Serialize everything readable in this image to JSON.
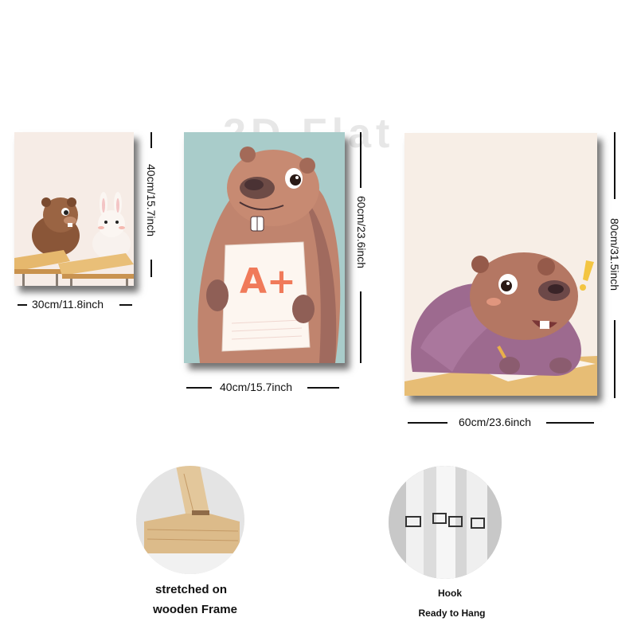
{
  "watermark": "2D Flat",
  "sizes": {
    "small": {
      "width": "30cm/11.8inch",
      "height": "40cm/15.7inch"
    },
    "medium": {
      "width": "40cm/15.7inch",
      "height": "60cm/23.6inch"
    },
    "large": {
      "width": "60cm/23.6inch",
      "height": "80cm/31.5inch"
    }
  },
  "paintings": {
    "medium": {
      "paper_text": "A+"
    }
  },
  "details": {
    "frame": {
      "caption_line1": "stretched on",
      "caption_line2": "wooden Frame"
    },
    "hook": {
      "caption_title": "Hook",
      "caption_sub": "Ready to Hang"
    }
  },
  "colors": {
    "small_bg": "#f6ece6",
    "medium_bg": "#a9ccca",
    "large_bg": "#f7eee6",
    "capybara": "#b47763",
    "grade": "#f07a5a"
  }
}
